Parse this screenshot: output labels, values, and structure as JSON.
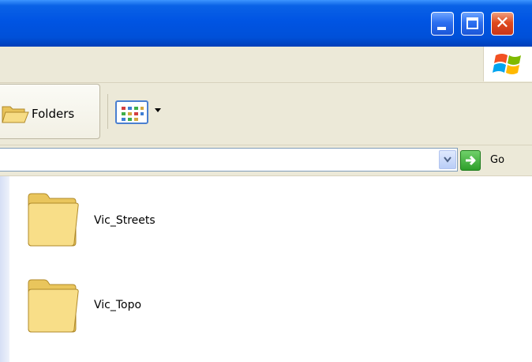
{
  "window": {
    "controls": {
      "minimize_icon": "minimize-icon",
      "maximize_icon": "maximize-icon",
      "close_icon": "close-icon",
      "close_glyph": "✕"
    },
    "colors": {
      "titlebar": "#0054e3",
      "chrome": "#ece9d8",
      "close": "#e04a1e"
    }
  },
  "toolbar": {
    "folders_label": "Folders",
    "folders_icon": "folder-icon",
    "views_icon": "views-icon"
  },
  "address": {
    "value": "",
    "go_label": "Go",
    "go_icon": "go-arrow-icon"
  },
  "content": {
    "items": [
      {
        "name": "Vic_Streets",
        "icon": "folder-icon"
      },
      {
        "name": "Vic_Topo",
        "icon": "folder-icon"
      }
    ]
  }
}
